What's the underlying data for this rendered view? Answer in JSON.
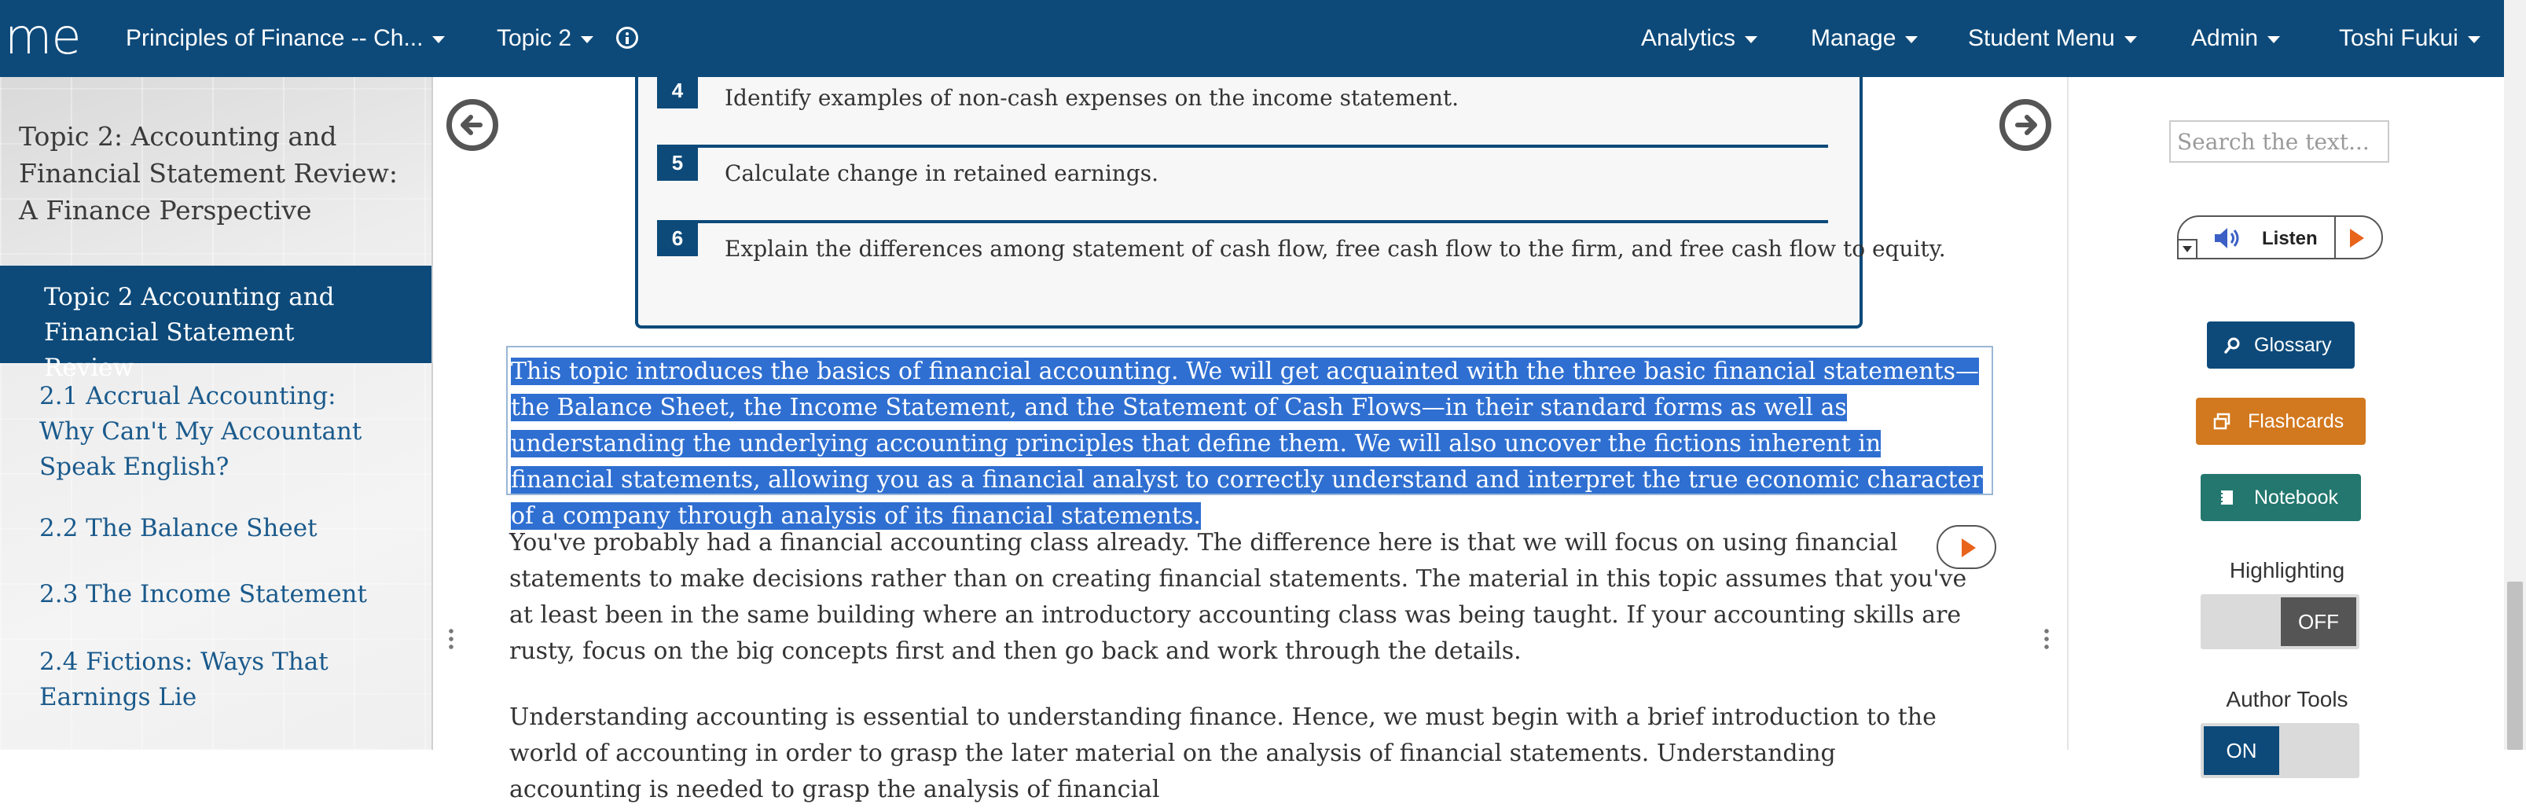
{
  "nav": {
    "logo": "me",
    "course": "Principles of Finance -- Ch...",
    "topic": "Topic 2",
    "analytics": "Analytics",
    "manage": "Manage",
    "student_menu": "Student Menu",
    "admin": "Admin",
    "user": "Toshi Fukui"
  },
  "sidebar": {
    "title": "Topic 2: Accounting and Financial Statement Review: A Finance Perspective",
    "current": "Topic 2 Accounting and Financial Statement Review",
    "items": [
      "2.1 Accrual Accounting: Why Can't My Accountant Speak English?",
      "2.2 The Balance Sheet",
      "2.3 The Income Statement",
      "2.4 Fictions: Ways That Earnings Lie"
    ]
  },
  "objectives": [
    {
      "num": "4",
      "text": "Identify examples of non-cash expenses on the income statement."
    },
    {
      "num": "5",
      "text": "Calculate change in retained earnings."
    },
    {
      "num": "6",
      "text": "Explain the differences among statement of cash flow, free cash flow to the firm, and free cash flow to equity."
    }
  ],
  "content": {
    "intro": "This topic introduces the basics of financial accounting. We will get acquainted with the three basic financial statements—the Balance Sheet, the Income Statement, and the Statement of Cash Flows—in their standard forms as well as understanding the underlying accounting principles that define them. We will also uncover the fictions inherent in financial statements, allowing you as a financial analyst to correctly understand and interpret the true economic character of a company through analysis of its financial statements.",
    "para1": "You've probably had a financial accounting class already. The difference here is that we will focus on using financial statements to make decisions rather than on creating financial statements. The material in this topic assumes that you've at least been in the same building where an introductory accounting class was being taught. If your accounting skills are rusty, focus on the big concepts first and then go back and work through the details.",
    "para2": "Understanding accounting is essential to understanding finance. Hence, we must begin with a brief introduction to the world of accounting in order to grasp the later material on the analysis of financial statements. Understanding accounting is needed to grasp the analysis of financial"
  },
  "right": {
    "search_placeholder": "Search the text...",
    "listen": "Listen",
    "glossary": "Glossary",
    "flashcards": "Flashcards",
    "notebook": "Notebook",
    "highlighting": "Highlighting",
    "highlighting_state": "OFF",
    "author_tools": "Author Tools",
    "author_tools_state": "ON"
  },
  "colors": {
    "nav": "#0d4a7a",
    "glossary": "#0d4a7a",
    "flashcards": "#d2781e",
    "notebook": "#23776e",
    "highlight": "#2f6fd1",
    "play": "#e8641b"
  }
}
